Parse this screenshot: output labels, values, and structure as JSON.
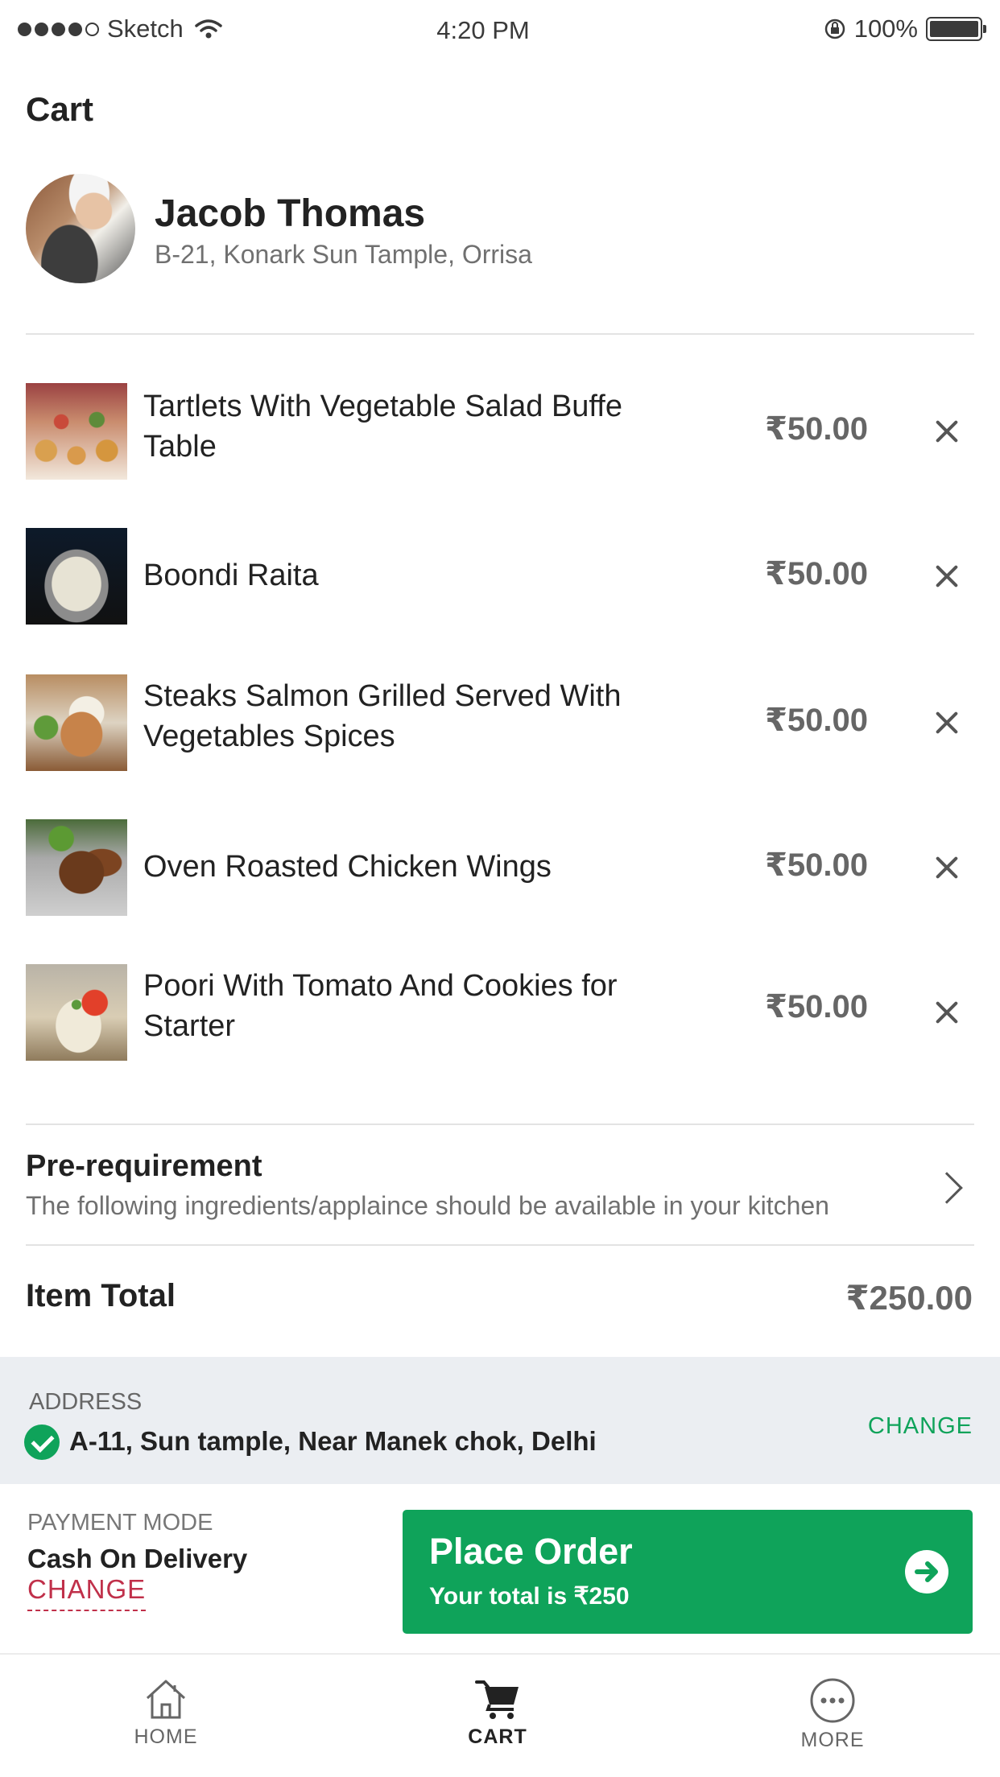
{
  "status_bar": {
    "carrier": "Sketch",
    "time": "4:20 PM",
    "battery": "100%"
  },
  "header": {
    "title": "Cart"
  },
  "profile": {
    "name": "Jacob Thomas",
    "address": "B-21, Konark Sun Tample, Orrisa"
  },
  "cart": {
    "items": [
      {
        "name": "Tartlets With Vegetable Salad Buffe Table",
        "price": "₹50.00"
      },
      {
        "name": "Boondi Raita",
        "price": "₹50.00"
      },
      {
        "name": "Steaks Salmon Grilled Served With Vegetables Spices",
        "price": "₹50.00"
      },
      {
        "name": "Oven Roasted Chicken Wings",
        "price": "₹50.00"
      },
      {
        "name": "Poori With Tomato And Cookies for Starter",
        "price": "₹50.00"
      }
    ]
  },
  "prerequirement": {
    "title": "Pre-requirement",
    "description": "The following ingredients/applaince should be available in your kitchen"
  },
  "totals": {
    "label": "Item Total",
    "value": "₹250.00"
  },
  "address": {
    "heading": "ADDRESS",
    "value": "A-11, Sun tample, Near Manek chok, Delhi",
    "change_label": "CHANGE"
  },
  "payment": {
    "label": "PAYMENT MODE",
    "value": "Cash On Delivery",
    "change_label": "CHANGE"
  },
  "place_order": {
    "title": "Place Order",
    "subtitle": "Your total is ₹250"
  },
  "tab_bar": {
    "tabs": [
      {
        "label": "HOME",
        "icon": "home-icon",
        "active": false
      },
      {
        "label": "CART",
        "icon": "cart-icon",
        "active": true
      },
      {
        "label": "MORE",
        "icon": "more-icon",
        "active": false
      }
    ]
  },
  "colors": {
    "accent_green": "#0fa35a",
    "change_red": "#c0304a",
    "address_panel_bg": "#ebeef2"
  }
}
